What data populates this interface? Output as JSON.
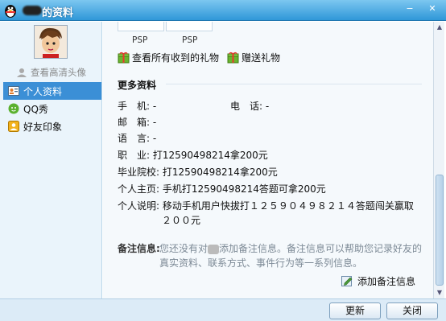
{
  "window": {
    "title": "的资料",
    "min_icon": "minimize-icon",
    "close_icon": "close-icon"
  },
  "sidebar": {
    "view_hd_avatar": "查看高清头像",
    "items": [
      {
        "label": "个人资料",
        "icon": "profile-card-icon",
        "active": true
      },
      {
        "label": "QQ秀",
        "icon": "qq-show-icon",
        "active": false
      },
      {
        "label": "好友印象",
        "icon": "friend-impression-icon",
        "active": false
      }
    ]
  },
  "gifts": {
    "items": [
      {
        "label": "PSP"
      },
      {
        "label": "PSP"
      }
    ],
    "view_all": "查看所有收到的礼物",
    "send": "赠送礼物"
  },
  "more_info": {
    "section_title": "更多资料",
    "phone_label": "手　机:",
    "phone_value": "-",
    "tel_label": "电　话:",
    "tel_value": "-",
    "email_label": "邮　箱:",
    "email_value": "-",
    "lang_label": "语　言:",
    "lang_value": "-",
    "job_label": "职　业:",
    "job_value": "打12590498214拿200元",
    "school_label": "毕业院校:",
    "school_value": "打12590498214拿200元",
    "homepage_label": "个人主页:",
    "homepage_value": "手机打12590498214答题可拿200元",
    "desc_label": "个人说明:",
    "desc_value_line1": "移动手机用户快拔打１２５９０４９８２１４答题闯关赢取",
    "desc_value_line2": "２００元"
  },
  "remark": {
    "label": "备注信息:",
    "text_pre": "您还没有对",
    "text_post": "添加备注信息。备注信息可以帮助您记录好友的真实资料、联系方式、事件行为等一系列信息。",
    "add_label": "添加备注信息"
  },
  "buttons": {
    "refresh": "更新",
    "close": "关闭"
  },
  "colors": {
    "titlebar": "#2f97d8",
    "nav_active": "#3b8fd6"
  }
}
